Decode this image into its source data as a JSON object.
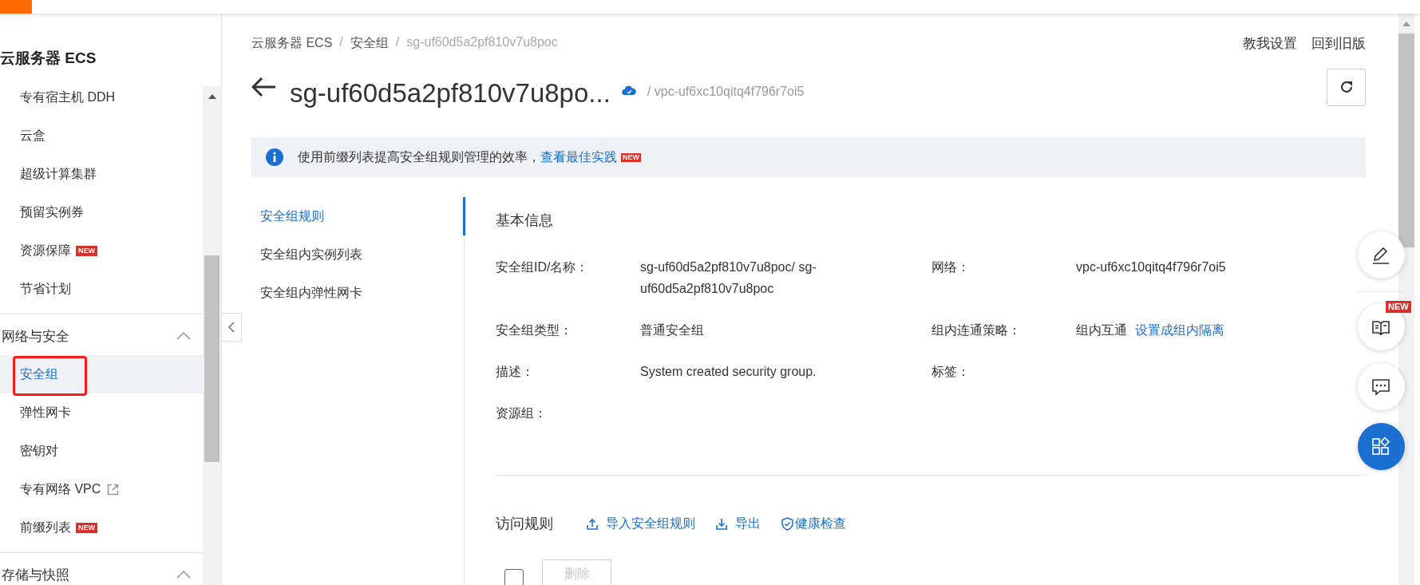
{
  "sidebar": {
    "title": "云服务器 ECS",
    "items": [
      {
        "label": "专有宿主机 DDH",
        "kind": "page",
        "selected": false,
        "annotated": false
      },
      {
        "label": "云盒",
        "kind": "page",
        "selected": false,
        "annotated": false
      },
      {
        "label": "超级计算集群",
        "kind": "page",
        "selected": false,
        "annotated": false
      },
      {
        "label": "预留实例券",
        "kind": "page",
        "selected": false,
        "annotated": false
      },
      {
        "label": "资源保障",
        "kind": "page",
        "badge": "NEW",
        "selected": false,
        "annotated": false
      },
      {
        "label": "节省计划",
        "kind": "page",
        "selected": false,
        "annotated": false
      }
    ],
    "groups": [
      {
        "label": "网络与安全",
        "expanded": true,
        "children": [
          {
            "label": "安全组",
            "kind": "page",
            "selected": true,
            "annotated": true
          },
          {
            "label": "弹性网卡",
            "kind": "page",
            "selected": false,
            "annotated": false
          },
          {
            "label": "密钥对",
            "kind": "page",
            "selected": false,
            "annotated": false
          },
          {
            "label": "专有网络 VPC",
            "kind": "external",
            "selected": false,
            "annotated": false
          },
          {
            "label": "前缀列表",
            "kind": "page",
            "badge": "NEW",
            "selected": false,
            "annotated": false
          }
        ]
      },
      {
        "label": "存储与快照",
        "expanded": true
      }
    ]
  },
  "breadcrumb": [
    {
      "kind": "link",
      "label": "云服务器 ECS"
    },
    {
      "kind": "separator",
      "label": "/"
    },
    {
      "kind": "link",
      "label": "安全组"
    },
    {
      "kind": "separator",
      "label": "/"
    },
    {
      "kind": "current",
      "label": "sg-uf60d5a2pf810v7u8poc"
    }
  ],
  "header_links": [
    "教我设置",
    "回到旧版"
  ],
  "title": "sg-uf60d5a2pf810v7u8po...",
  "subtitle": "/ vpc-uf6xc10qitq4f796r7oi5",
  "notice": {
    "text": "使用前缀列表提高安全组规则管理的效率，",
    "link": "查看最佳实践",
    "badge": "NEW"
  },
  "side_tabs": [
    {
      "label": "安全组规则",
      "selected": true
    },
    {
      "label": "安全组内实例列表",
      "selected": false
    },
    {
      "label": "安全组内弹性网卡",
      "selected": false
    }
  ],
  "basic_info": {
    "title": "基本信息",
    "fields": [
      {
        "label": "安全组ID/名称：",
        "value": "sg-uf60d5a2pf810v7u8poc/ sg-uf60d5a2pf810v7u8poc"
      },
      {
        "label": "网络：",
        "value": "vpc-uf6xc10qitq4f796r7oi5"
      },
      {
        "label": "安全组类型：",
        "value": "普通安全组"
      },
      {
        "label": "组内连通策略：",
        "value": "组内互通",
        "link": "设置成组内隔离"
      },
      {
        "label": "描述：",
        "value": "System created security group."
      },
      {
        "label": "标签："
      },
      {
        "label": "资源组："
      }
    ]
  },
  "rules": {
    "title": "访问规则",
    "actions": [
      {
        "kind": "upload",
        "label": "导入安全组规则"
      },
      {
        "kind": "download",
        "label": "导出"
      },
      {
        "kind": "shield",
        "label": "健康检查"
      }
    ],
    "select_all": {
      "checked": false
    },
    "delete_button": {
      "label": "删除",
      "disabled": true
    }
  },
  "float_buttons": [
    {
      "kind": "edit"
    },
    {
      "kind": "guide",
      "badge": "NEW"
    },
    {
      "kind": "chat"
    },
    {
      "kind": "apps"
    }
  ]
}
